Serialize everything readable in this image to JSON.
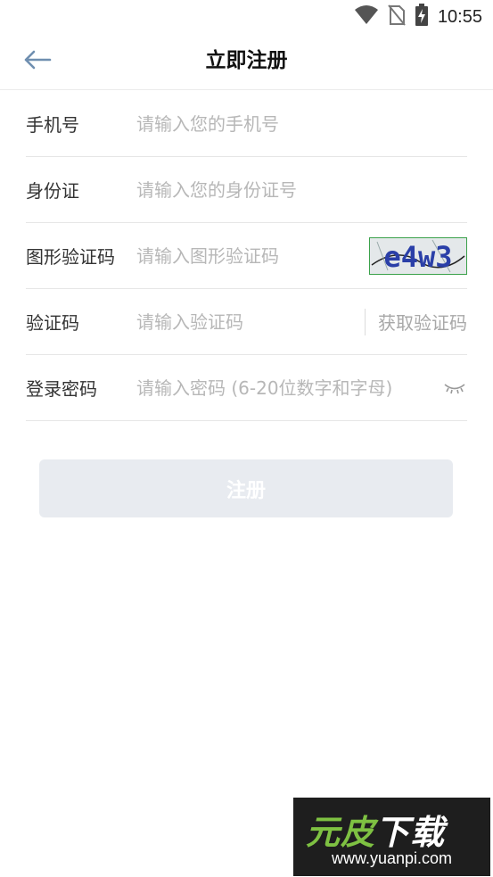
{
  "status_bar": {
    "time": "10:55",
    "icons": [
      "wifi-icon",
      "no-sim-icon",
      "battery-charging-icon"
    ]
  },
  "header": {
    "back_icon": "arrow-left-icon",
    "title": "立即注册"
  },
  "form": {
    "phone": {
      "label": "手机号",
      "placeholder": "请输入您的手机号"
    },
    "id_card": {
      "label": "身份证",
      "placeholder": "请输入您的身份证号"
    },
    "captcha": {
      "label": "图形验证码",
      "placeholder": "请输入图形验证码",
      "image_text": "e4w3"
    },
    "sms_code": {
      "label": "验证码",
      "placeholder": "请输入验证码",
      "action": "获取验证码"
    },
    "password": {
      "label": "登录密码",
      "placeholder": "请输入密码 (6-20位数字和字母)",
      "eye_icon": "eye-closed-icon"
    }
  },
  "submit": {
    "label": "注册"
  },
  "watermark": {
    "logo_text": "元皮下载",
    "url": "www.yuanpi.com"
  },
  "colors": {
    "accent_back": "#6f8fb0",
    "button_disabled": "#e8ebf0",
    "placeholder": "#b7b7b7",
    "watermark_green": "#7ec142"
  }
}
